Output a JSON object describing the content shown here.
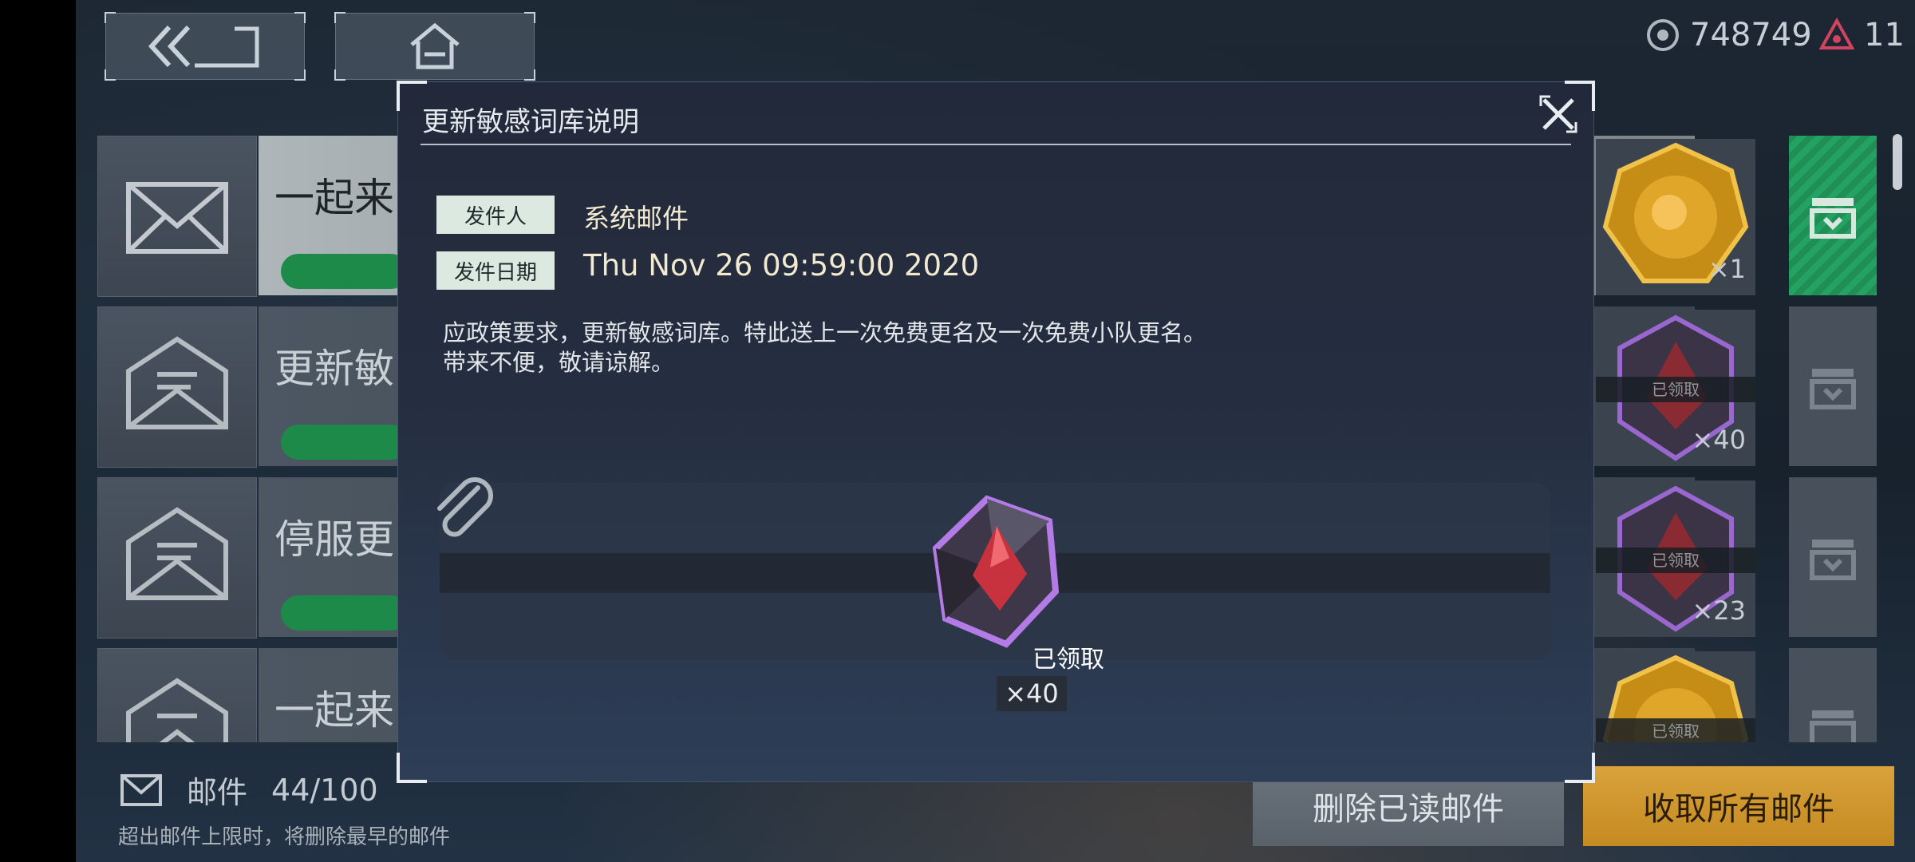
{
  "top_bar": {
    "back_icon": "double-chevron-back-icon",
    "home_icon": "home-icon",
    "currency_1": {
      "icon": "eye-coin-icon",
      "value": "748749"
    },
    "currency_2": {
      "icon": "triangle-gem-icon",
      "value": "11"
    }
  },
  "mail_list": [
    {
      "title": "一起来",
      "state": "unread",
      "reward_count": "×1",
      "reward_claimed": false,
      "reward_icon": "gold-medal-icon"
    },
    {
      "title": "更新敏",
      "state": "read",
      "reward_count": "×40",
      "reward_claimed": true,
      "reward_claimed_label": "已领取",
      "reward_icon": "crystal-icon"
    },
    {
      "title": "停服更",
      "state": "read",
      "reward_count": "×23",
      "reward_claimed": true,
      "reward_claimed_label": "已领取",
      "reward_icon": "crystal-icon"
    },
    {
      "title": "一起来",
      "state": "read",
      "reward_count": "",
      "reward_claimed": true,
      "reward_claimed_label": "已领取",
      "reward_icon": "gold-medal-icon"
    }
  ],
  "footer": {
    "mail_label": "邮件",
    "mail_count": "44/100",
    "hint": "超出邮件上限时，将删除最早的邮件",
    "delete_read_label": "删除已读邮件",
    "collect_all_label": "收取所有邮件"
  },
  "modal": {
    "title": "更新敏感词库说明",
    "sender_label": "发件人",
    "sender_value": "系统邮件",
    "date_label": "发件日期",
    "date_value": "Thu Nov 26 09:59:00 2020",
    "message_line_1": "应政策要求，更新敏感词库。特此送上一次免费更名及一次免费小队更名。",
    "message_line_2": "带来不便，敬请谅解。",
    "attachment": {
      "icon": "crystal-icon",
      "status": "已领取",
      "count": "×40"
    }
  },
  "colors": {
    "claim_green": "#1f8f55",
    "collect_gold": "#d9a23a",
    "tag_bg": "#dbe9e0",
    "accent_purple": "#b27be6"
  }
}
